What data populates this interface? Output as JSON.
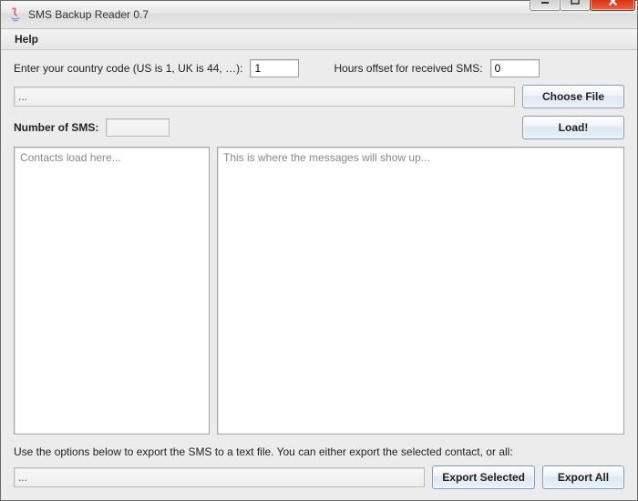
{
  "window": {
    "title": "SMS Backup Reader 0.7"
  },
  "menu": {
    "help": "Help"
  },
  "inputs": {
    "country_code_label": "Enter your country code (US is 1, UK is 44, …):",
    "country_code_value": "1",
    "hours_offset_label": "Hours offset for received SMS:",
    "hours_offset_value": "0",
    "input_file_path": "...",
    "choose_file_label": "Choose File",
    "sms_count_label": "Number of SMS:",
    "sms_count_value": "",
    "load_label": "Load!"
  },
  "panels": {
    "contacts_placeholder": "Contacts load here...",
    "messages_placeholder": "This is where the messages will show up..."
  },
  "export": {
    "instructions": "Use the options below to export the SMS to a text file. You can either export the selected contact, or all:",
    "export_file_path": "...",
    "export_selected_label": "Export Selected",
    "export_all_label": "Export All"
  }
}
